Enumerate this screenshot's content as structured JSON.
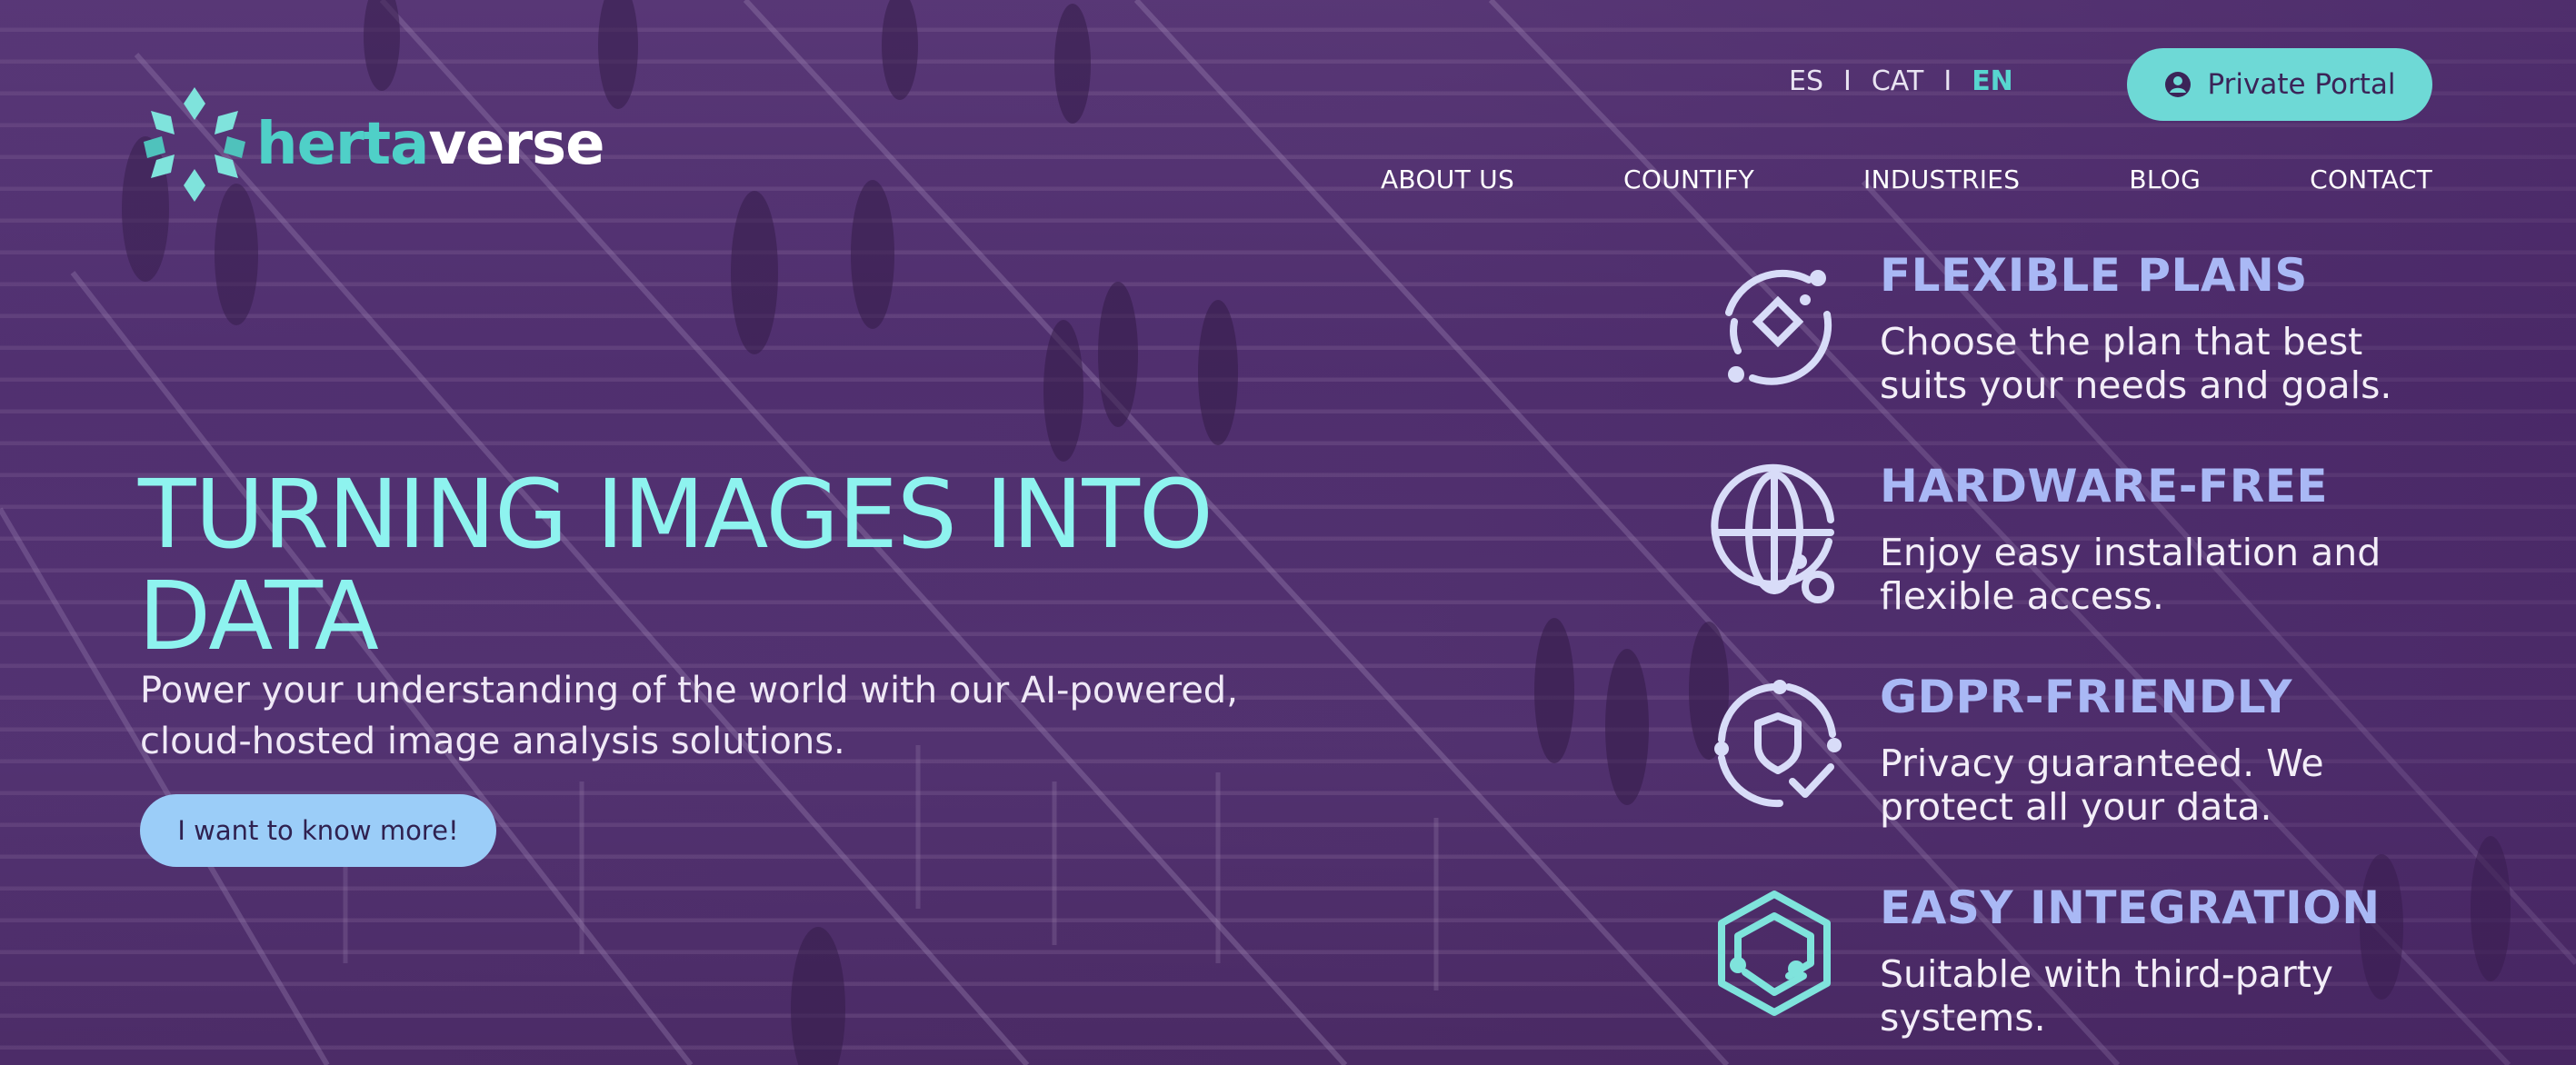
{
  "brand": {
    "name_part1": "herta",
    "name_part2": "verse",
    "accent_color": "#4fd0c8"
  },
  "languages": {
    "items": [
      "ES",
      "CAT",
      "EN"
    ],
    "separator": "I",
    "active": "EN"
  },
  "portal_button": {
    "label": "Private Portal",
    "icon": "user-circle-icon"
  },
  "nav": {
    "items": [
      "ABOUT US",
      "COUNTIFY",
      "INDUSTRIES",
      "BLOG",
      "CONTACT"
    ]
  },
  "hero": {
    "title": "TURNING IMAGES INTO DATA",
    "subtitle": "Power your understanding of the world with our AI-powered, cloud-hosted image analysis solutions.",
    "cta_label": "I want to know more!",
    "title_color": "#8ef3ef",
    "cta_color": "#9bcdf8"
  },
  "features": [
    {
      "icon": "plans-orbit-icon",
      "title": "FLEXIBLE PLANS",
      "description": "Choose the plan that best suits your needs and goals."
    },
    {
      "icon": "globe-icon",
      "title": "HARDWARE-FREE",
      "description": "Enjoy easy installation and flexible access."
    },
    {
      "icon": "shield-check-icon",
      "title": "GDPR-FRIENDLY",
      "description": "Privacy guaranteed. We protect all your data."
    },
    {
      "icon": "hexagon-integration-icon",
      "title": "EASY INTEGRATION",
      "description": "Suitable with third-party systems."
    }
  ],
  "colors": {
    "feature_title": "#a9b8f5",
    "portal_button": "#6ed9d6",
    "overlay": "#4e2c6c"
  }
}
